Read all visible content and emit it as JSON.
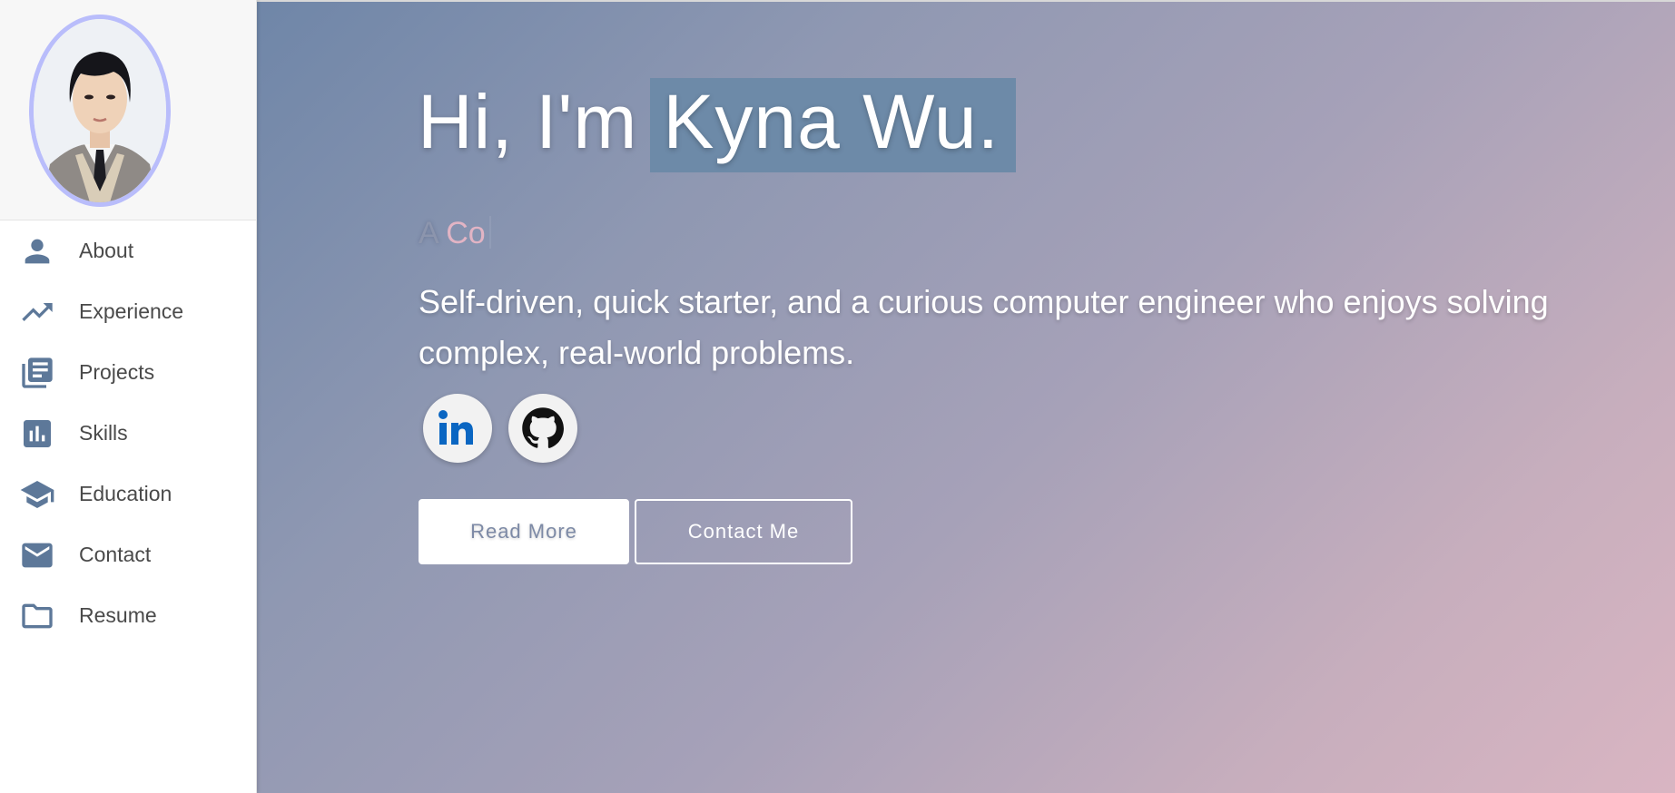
{
  "sidebar": {
    "avatar_alt": "Profile photo",
    "items": [
      {
        "label": "About",
        "icon": "person-icon"
      },
      {
        "label": "Experience",
        "icon": "trending-up-icon"
      },
      {
        "label": "Projects",
        "icon": "library-books-icon"
      },
      {
        "label": "Skills",
        "icon": "bar-chart-icon"
      },
      {
        "label": "Education",
        "icon": "school-icon"
      },
      {
        "label": "Contact",
        "icon": "mail-icon"
      },
      {
        "label": "Resume",
        "icon": "folder-icon"
      }
    ]
  },
  "hero": {
    "greeting": "Hi, I'm",
    "name": "Kyna Wu.",
    "typed_prefix_faded": "A ",
    "typed_text": "Co",
    "description": "Self-driven, quick starter, and a curious computer engineer who enjoys solving complex, real-world problems.",
    "social": [
      {
        "name": "LinkedIn",
        "icon": "linkedin-icon"
      },
      {
        "name": "GitHub",
        "icon": "github-icon"
      }
    ],
    "buttons": {
      "read_more": "Read More",
      "contact_me": "Contact Me"
    }
  },
  "colors": {
    "accent": "#6d8aa8",
    "icon": "#5d7899",
    "avatar_border": "#b9bdfb",
    "gradient_start": "#6f86a8",
    "gradient_end": "#d9b5c2"
  }
}
